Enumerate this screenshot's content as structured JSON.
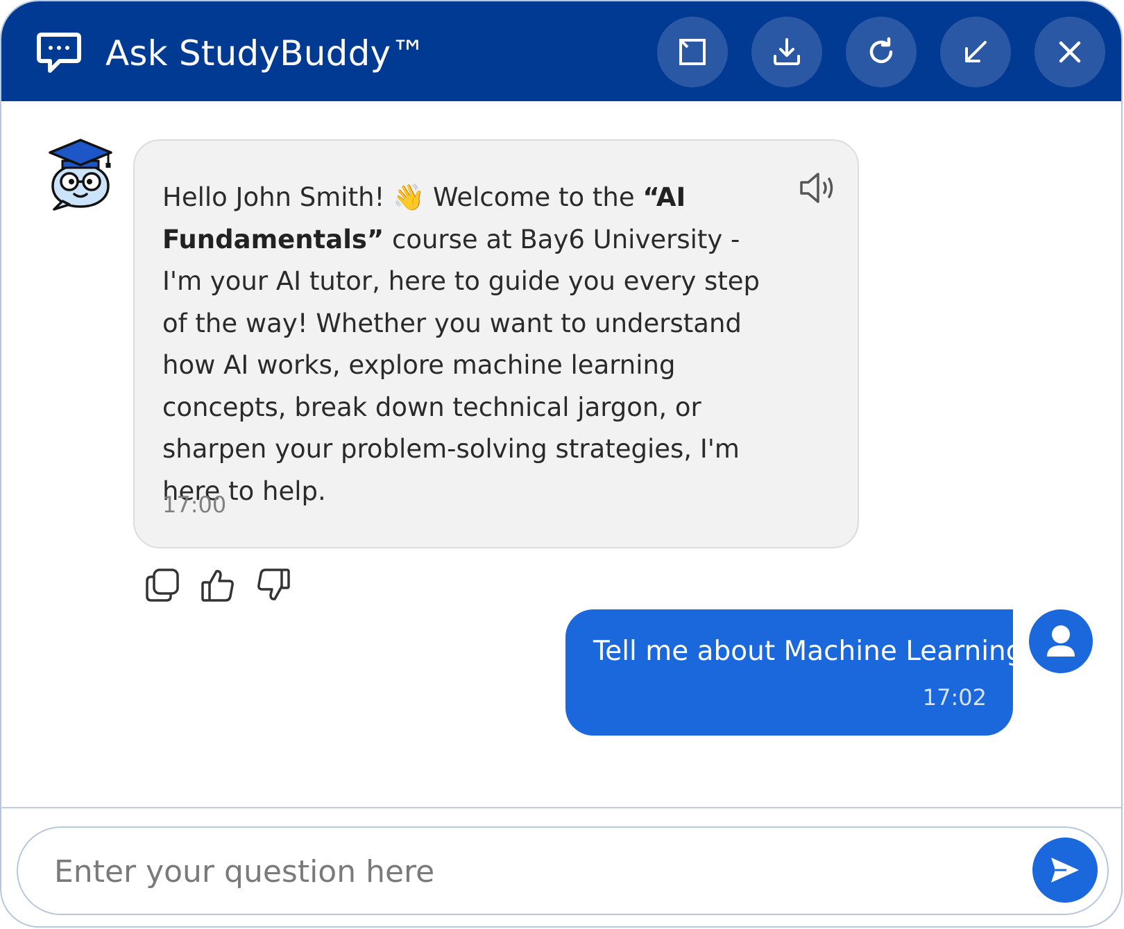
{
  "header": {
    "title": "Ask StudyBuddy™",
    "icons": {
      "chat": "chat-bubble-icon",
      "expand": "expand-icon",
      "download": "download-icon",
      "refresh": "refresh-icon",
      "minimize": "minimize-icon",
      "close": "close-icon"
    }
  },
  "messages": [
    {
      "from": "bot",
      "greeting": "Hello John Smith! ",
      "wave_emoji": "👋",
      "text_before_bold": " Welcome to the ",
      "bold_course": "“AI Fundamentals”",
      "text_after_bold": " course at Bay6 University - I'm your AI tutor, here to guide you every step of the way! Whether you want to understand how AI works, explore machine learning concepts, break down technical jargon, or sharpen your problem-solving strategies, I'm here to help.",
      "time": "17:00"
    },
    {
      "from": "user",
      "text": "Tell me about Machine Learning",
      "time": "17:02"
    }
  ],
  "input": {
    "placeholder": "Enter your question here"
  },
  "colors": {
    "header_bg": "#003a92",
    "header_button_bg": "#2b58a4",
    "accent": "#1b67dc",
    "bot_bubble_bg": "#f2f2f2"
  }
}
